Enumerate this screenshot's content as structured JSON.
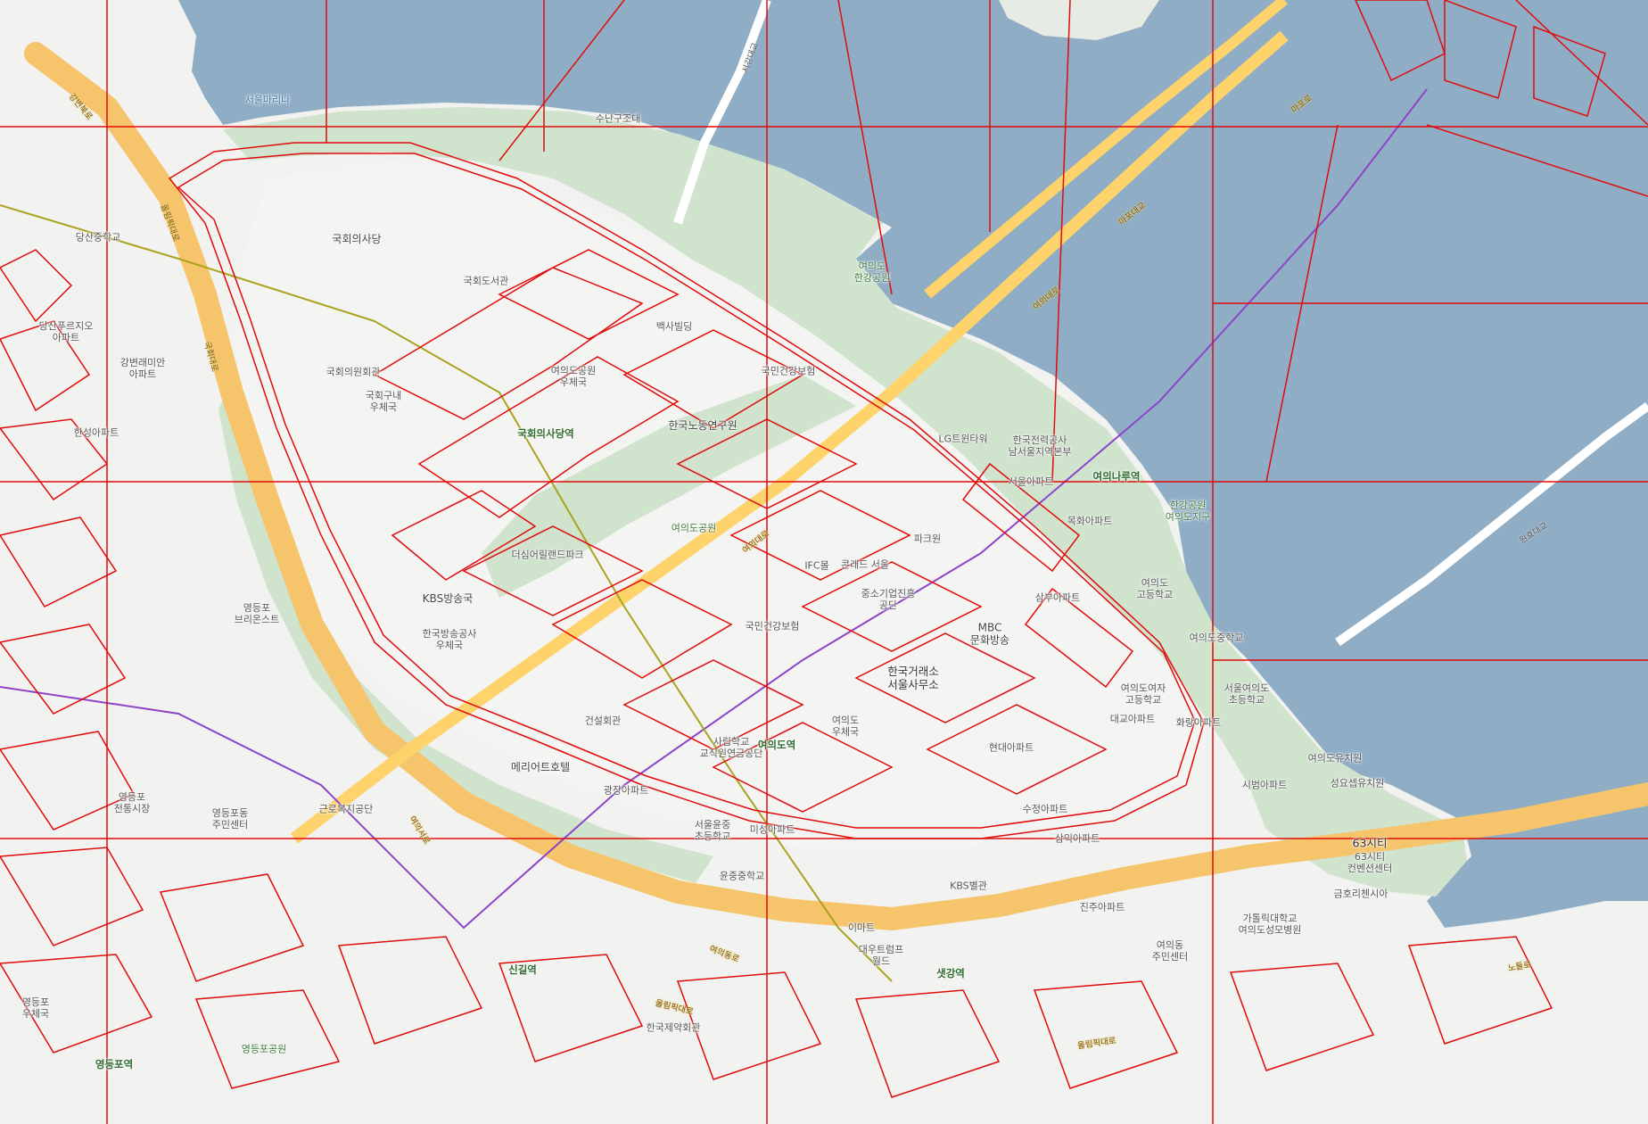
{
  "map": {
    "colors": {
      "water": "#90adc6",
      "land": "#f2f2f0",
      "park": "#cfe3cd",
      "highway": "#f6c46a",
      "arterial": "#ffd36b",
      "overlay_lines": "#e00b0b",
      "subway_purple": "#8e44c9",
      "subway_olive": "#a9a31d"
    },
    "labels": {
      "seoul_marina": "서울마리나",
      "rescue_team": "수난구조대",
      "national_assembly": "국회의사당",
      "assembly_library": "국회도서관",
      "assembly_hall": "국회의원회관",
      "assembly_post": "국회구내\n우체국",
      "assembly_station": "국회의사당역",
      "yeouido_park_post": "여의도공원\n우체국",
      "parking_bldg": "백사빌딩",
      "nhis": "국민건강보험",
      "korea_labor": "한국노동연구원",
      "lg_twin": "LG트윈타워",
      "kepco": "한국전력공사\n남서울지역본부",
      "yeouido_hangang_park": "여의도\n한강공원",
      "seoul_apt": "서울아파트",
      "yeouinaru_station": "여의나루역",
      "mokhwa_apt": "목화아파트",
      "hangang_park_district": "한강공원\n여의도지구",
      "yeouido_park": "여의도공원",
      "the_sky_park": "더심어릴랜드파크",
      "parc1": "파크원",
      "ifc": "IFC몰",
      "conrad": "콘래드 서울",
      "kbs": "KBS방송국",
      "kbs_post": "한국방송공사\n우체국",
      "smba": "중소기업진흥\n공단",
      "mbc": "MBC\n문화방송",
      "nhis2": "국민건강보험",
      "krx": "한국거래소\n서울사무소",
      "sangsu_apt": "삼부아파트",
      "yeouido_hs": "여의도\n고등학교",
      "yeouido_ms": "여의도중학교",
      "yeouido_girls": "여의도여자\n고등학교",
      "seoul_yeouido_es": "서울여의도\n초등학교",
      "daegyo_apt": "대교아파트",
      "hwarang_apt": "화랑아파트",
      "yeouido_kinder": "여의도유치원",
      "sungeun_kinder": "성요셉유치원",
      "sibeom_apt": "시범아파트",
      "construction_hall": "건설회관",
      "private_school": "사립학교\n교직원연금공단",
      "yeouido_station": "여의도역",
      "yeouido_post": "여의도\n우체국",
      "marriott": "메리어트호텔",
      "gwangjang_apt": "광장아파트",
      "seoul_yunjung_es": "서울윤중\n초등학교",
      "yunjung_ms": "윤중중학교",
      "ewha_apt": "미성아파트",
      "kbs_hall": "KBS별관",
      "samik_apt": "삼익아파트",
      "jingju_apt": "진주아파트",
      "hyundai_apt": "현대아파트",
      "suojung_apt": "수정아파트",
      "emart": "이마트",
      "daewoo_trump": "대우트럼프\n월드",
      "yeouido_community": "여의동\n주민센터",
      "catholic_hospital": "가톨릭대학교\n여의도성모병원",
      "sixtythree": "63시티",
      "sixtythree_conv": "63시티\n컨벤션센터",
      "kumho_res": "금호리첸시아",
      "singil_station": "신길역",
      "saetgang_station": "샛강역",
      "korea_jesu": "한국제약회관",
      "yeongdeungpo_park": "영등포공원",
      "yeongdeungpo_station": "영등포역",
      "yeongdeungpo_market": "영등포\n전통시장",
      "yeongdeungpo_post": "영등포\n우체국",
      "yeongdeungpo_market2": "영등포동\n주민센터",
      "yd_briefs": "영등포\n브리온스트",
      "kunro": "근로복지공단",
      "dangsan_ms": "당산중학교",
      "gangbyeon_apt": "강변래미안\n아파트",
      "dangsan_apt": "당산푸르지오\n아파트",
      "hwaseong_apt": "한성아파트",
      "mapo_bridge": "마포대교",
      "wonhyo_bridge": "원효대교",
      "seogang_bridge": "서강대교",
      "mapo_label": "마포로",
      "gangbyeon_buk": "강변북로",
      "olympic_road": "올림픽대로",
      "yeoui_road": "여의대로",
      "gukhoe_road": "국회대로",
      "yeouiseo_road": "여의서로",
      "yeouidong_road": "여의동로",
      "nodeul_road": "노들로"
    }
  }
}
